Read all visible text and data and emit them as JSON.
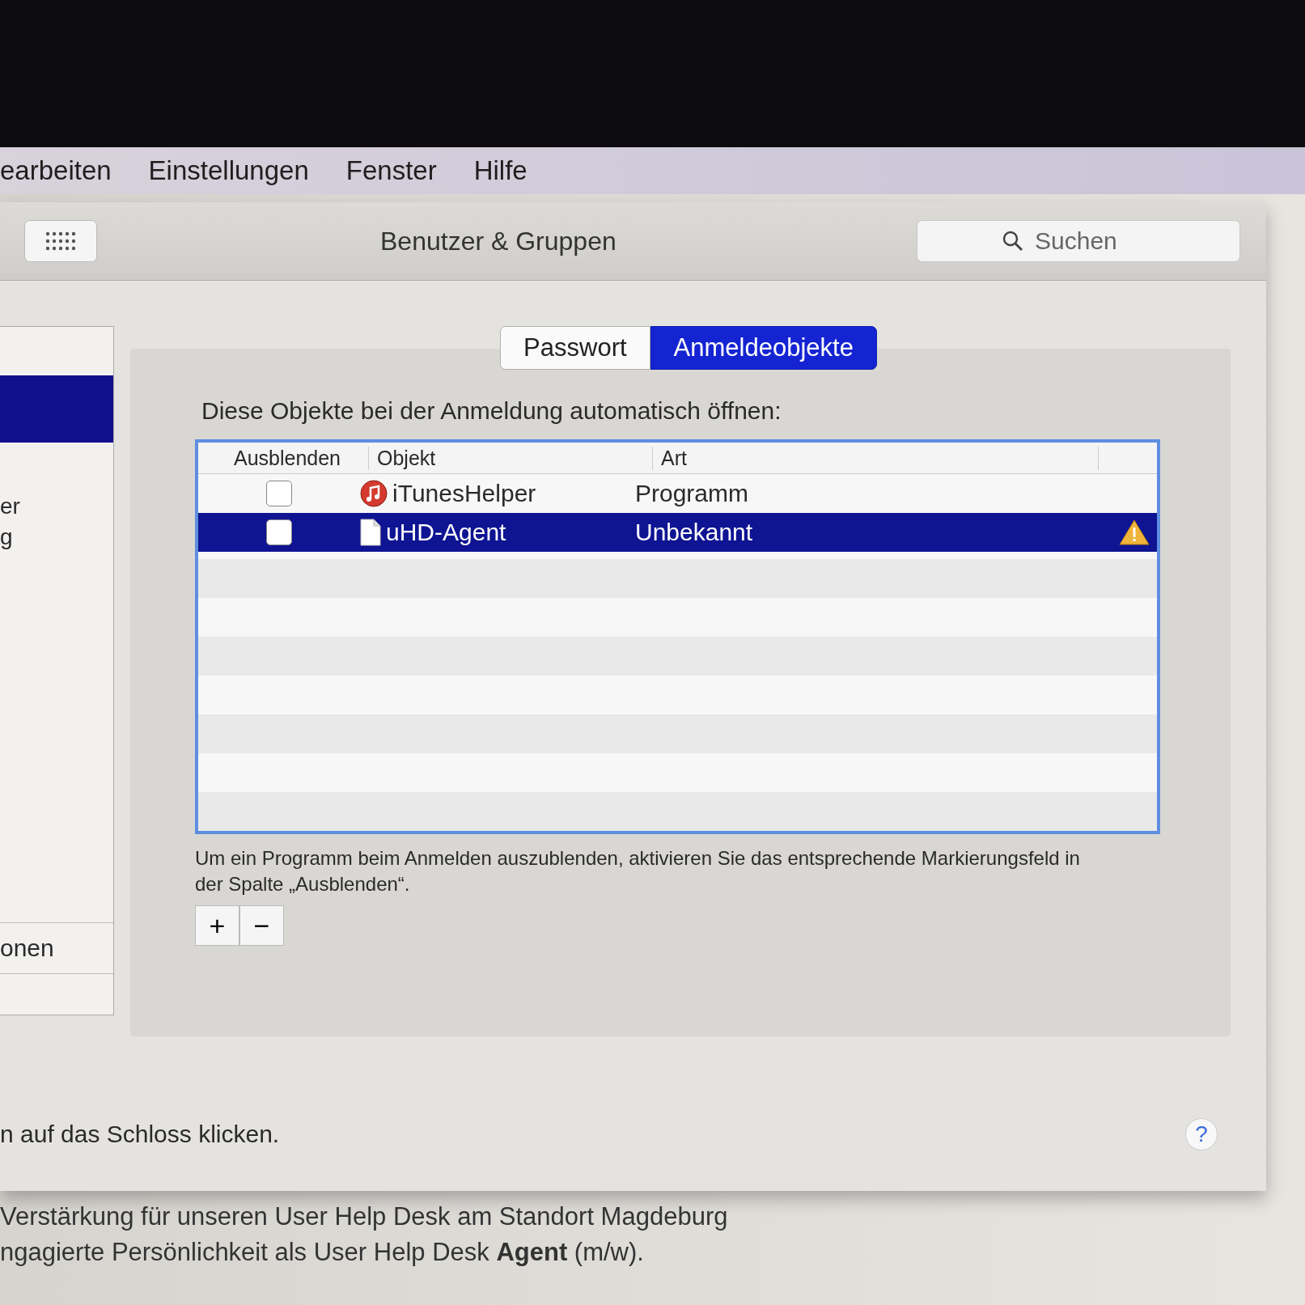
{
  "menu_bar": {
    "items": [
      "earbeiten",
      "Einstellungen",
      "Fenster",
      "Hilfe"
    ]
  },
  "window": {
    "title": "Benutzer & Gruppen",
    "search": {
      "placeholder": "Suchen"
    }
  },
  "sidebar": {
    "texts": [
      "er",
      "g"
    ],
    "footer": "onen"
  },
  "tabs": [
    {
      "label": "Passwort",
      "selected": false
    },
    {
      "label": "Anmeldeobjekte",
      "selected": true
    }
  ],
  "login_items": {
    "heading": "Diese Objekte bei der Anmeldung automatisch öffnen:",
    "columns": [
      "Ausblenden",
      "Objekt",
      "Art"
    ],
    "rows": [
      {
        "hide": false,
        "kind": "app",
        "name": "iTunesHelper",
        "type": "Programm",
        "selected": false,
        "warning": false
      },
      {
        "hide": false,
        "kind": "file",
        "name": "uHD-Agent",
        "type": "Unbekannt",
        "selected": true,
        "warning": true
      }
    ],
    "note": "Um ein Programm beim Anmelden auszublenden, aktivieren Sie das entsprechende Markierungsfeld in der Spalte „Ausblenden“.",
    "buttons": [
      "+",
      "−"
    ]
  },
  "lock_note": "n auf das Schloss klicken.",
  "help_button": "?",
  "background_page": {
    "lines": [
      " Verstärkung für unseren User Help Desk am Standort Magdeburg",
      "ngagierte Persönlichkeit als User Help Desk **Agent** (m/w)."
    ]
  }
}
